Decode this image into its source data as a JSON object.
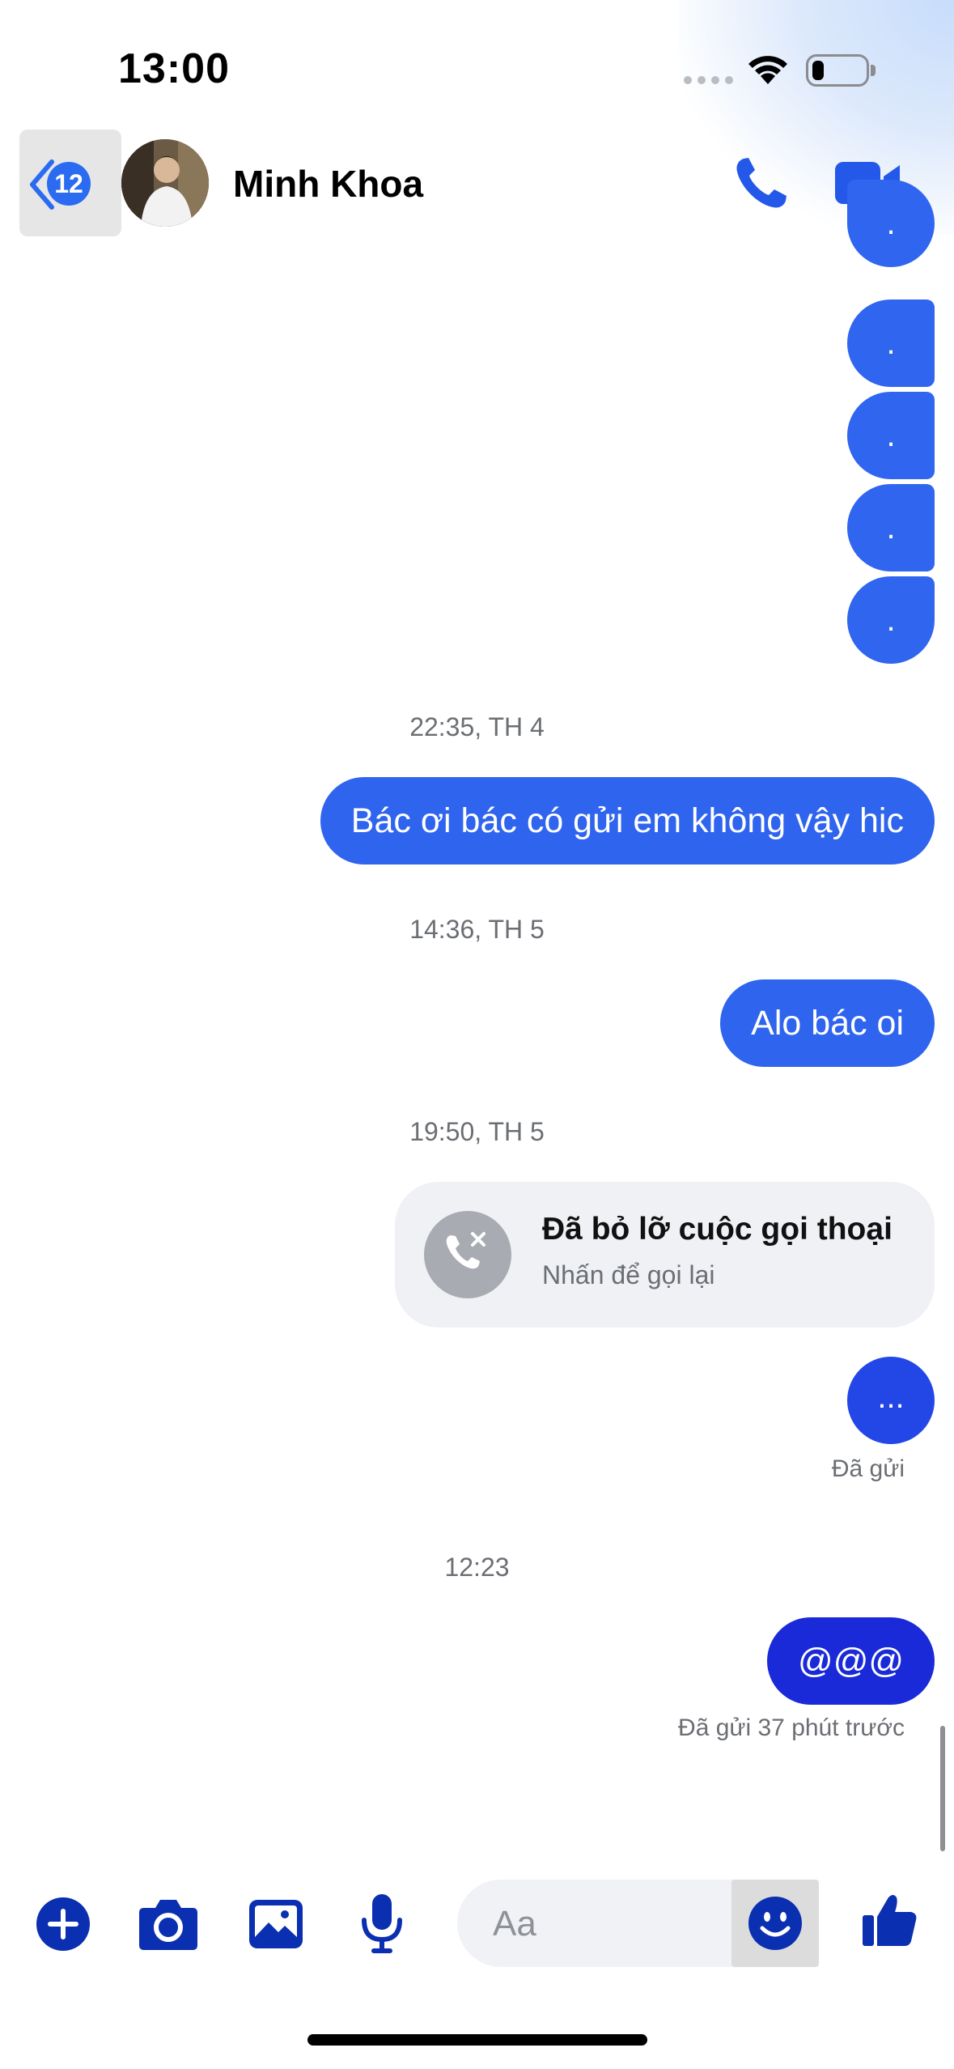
{
  "status_bar": {
    "time": "13:00"
  },
  "header": {
    "back_badge": "12",
    "contact_name": "Minh Khoa"
  },
  "messages": {
    "dot_char": ".",
    "timestamp_1": "22:35, TH 4",
    "msg_1": "Bác ơi bác có gửi em không vậy hic",
    "timestamp_2": "14:36, TH 5",
    "msg_2": "Alo bác oi",
    "timestamp_3": "19:50, TH 5",
    "missed_call_title": "Đã bỏ lỡ cuộc gọi thoại",
    "missed_call_sub": "Nhấn để gọi lại",
    "msg_3": "...",
    "sent_1": "Đã gửi",
    "timestamp_4": "12:23",
    "msg_4": "@@@",
    "sent_2": "Đã gửi 37 phút trước"
  },
  "composer": {
    "placeholder": "Aa",
    "icons": [
      "plus-icon",
      "camera-icon",
      "image-icon",
      "microphone-icon",
      "emoji-icon",
      "thumbs-up-icon"
    ]
  },
  "colors": {
    "accent_blue": "#2f64ee",
    "composer_icon_blue": "#0a2fb0",
    "missed_bg": "#eff1f5"
  }
}
